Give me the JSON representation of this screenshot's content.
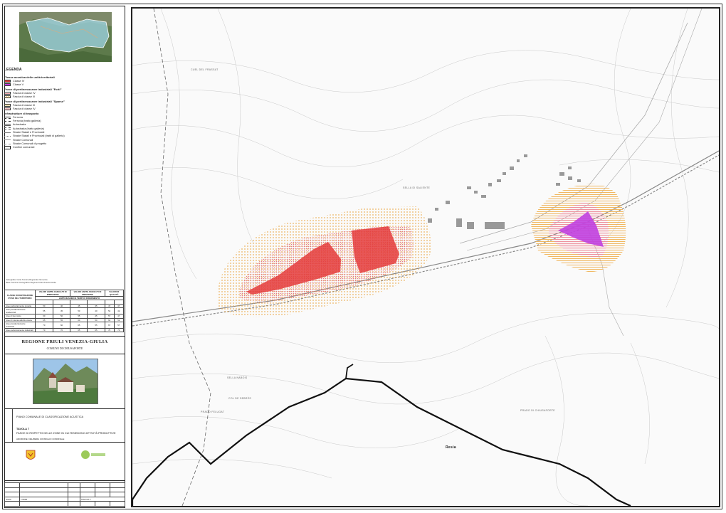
{
  "legend": {
    "title": "LEGENDA",
    "acoustic_header": "Classe acustica delle unità territoriali",
    "classes": [
      {
        "label": "Classe IV",
        "color": "#e43b3b"
      },
      {
        "label": "Classe V",
        "color": "#c040e0"
      }
    ],
    "forti_header": "Fasce di pertinenza aree industriali \"Forti\"",
    "forti": [
      {
        "label": "Fascia di classe IV"
      },
      {
        "label": "Fascia di classe III"
      }
    ],
    "sparse_header": "Fasce di pertinenza aree industriali \"Sparse\"",
    "sparse": [
      {
        "label": "Fascia di classe III"
      },
      {
        "label": "Fascia di classe IV"
      }
    ],
    "infra_header": "Infrastrutture di trasporto",
    "infra": [
      {
        "label": "Ferrovia"
      },
      {
        "label": "Ferrovia (tratto galleria)"
      },
      {
        "label": "Autostrada"
      },
      {
        "label": "Autostrada (tratto galleria)"
      },
      {
        "label": "Strade Statali e Provinciali"
      },
      {
        "label": "Strade Statali e Provinciali (tratti di galleria)"
      },
      {
        "label": "Strade Comunali"
      },
      {
        "label": "Strade Comunali di progetto"
      },
      {
        "label": "Confine comunale"
      }
    ],
    "source_note_1": "Cartografia: Carta Tecnica Regionale Numerica",
    "source_note_2": "Base: Servizio Cartografico Regione Friuli Venezia Giulia"
  },
  "table": {
    "col1": "CLASSE DI DESTINAZIONE D'USO DEL TERRITORIO",
    "col2": "VALORI LIMITE ASSOLUTI DI IMMISSIONE",
    "col3": "VALORI LIMITE ASSOLUTI DI EMISSIONE",
    "col4": "VALORI DI QUALITÀ",
    "sub": "LIMITI MASSIMI IN TEMPI DI RIFERIMENTO",
    "rows": [
      {
        "n": "I",
        "name": "Aree particolarmente protette",
        "v": [
          "50",
          "40",
          "45",
          "35",
          "47",
          "37"
        ]
      },
      {
        "n": "II",
        "name": "Aree prevalentemente residenziali",
        "v": [
          "55",
          "45",
          "50",
          "40",
          "52",
          "42"
        ]
      },
      {
        "n": "III",
        "name": "Aree di tipo misto",
        "v": [
          "60",
          "50",
          "55",
          "45",
          "57",
          "47"
        ]
      },
      {
        "n": "IV",
        "name": "Aree di intensa attività umana",
        "v": [
          "65",
          "55",
          "60",
          "50",
          "62",
          "52"
        ]
      },
      {
        "n": "V",
        "name": "Aree prevalentemente industriali",
        "v": [
          "70",
          "60",
          "65",
          "55",
          "67",
          "57"
        ]
      },
      {
        "n": "VI",
        "name": "Aree esclusivamente industriali",
        "v": [
          "70",
          "70",
          "65",
          "65",
          "70",
          "70"
        ]
      }
    ]
  },
  "region": {
    "name": "REGIONE FRIULI VENEZIA-GIULIA",
    "comune": "COMUNE DI CHIUSAFORTE"
  },
  "plan": {
    "title": "PIANO COMUNALE DI CLASSIFICAZIONE ACUSTICA",
    "tavola": "TAVOLA 7",
    "subtitle": "FASCE DI RISPETTO DELLE ZONE IN CUI RISIEDONO ATTIVITÀ PRODUTTIVE",
    "line1": "ADOZIONE: DELIBERA CONSIGLIO COMUNALE",
    "line2": "APPROVAZIONE: DELIBERA CONSIGLIO COMUNALE"
  },
  "bottom": {
    "scale_label": "Scala",
    "scale": "1:5000",
    "tavola_code": "TAVOLA 7"
  },
  "map_labels": {
    "resia": "Resia",
    "p1": "CUEL DEL FRASSAT",
    "p2": "SELLA NABOIS",
    "p3": "PRADO FELUGAT",
    "p4": "PRADO DI CHIUSAFORTE",
    "p5": "SELLA DI SALIENTE",
    "p6": "COL DE SEBRÈS"
  },
  "colors": {
    "class_iv": "#e43b3b",
    "class_v": "#c040e0",
    "band_iii": "#f2c46e",
    "band_iv": "#f0a0a8"
  }
}
